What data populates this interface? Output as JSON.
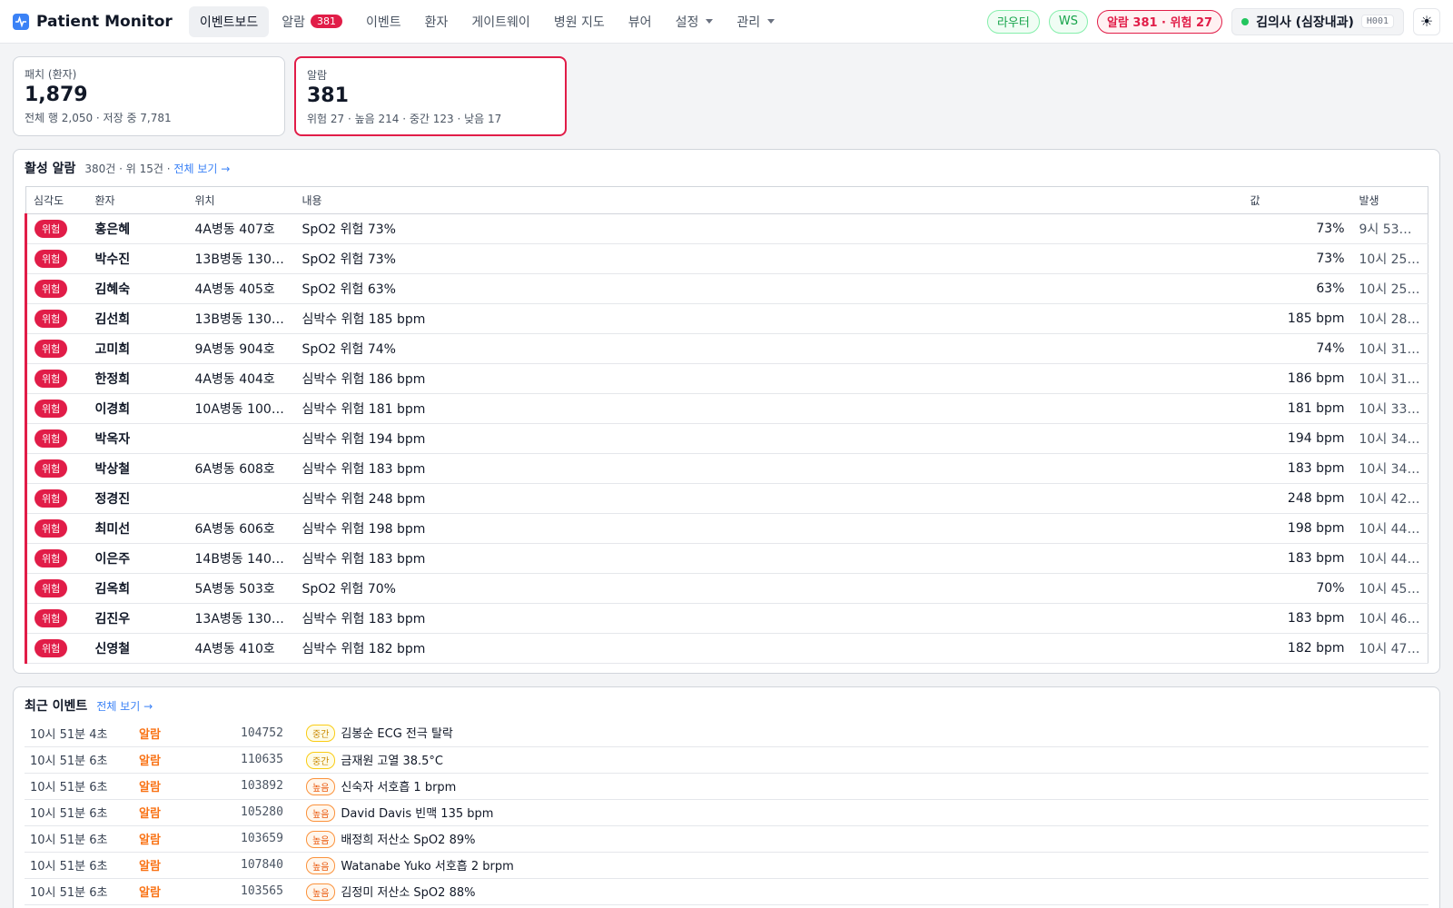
{
  "app": {
    "title": "Patient Monitor"
  },
  "nav": {
    "dashboard": "이벤트보드",
    "alarms": "알람",
    "alarms_count": "381",
    "events": "이벤트",
    "patients": "환자",
    "gateway": "게이트웨이",
    "hospital_map": "병원 지도",
    "viewer": "뷰어",
    "settings": "설정",
    "admin": "관리"
  },
  "status": {
    "router": "라우터",
    "ws": "WS",
    "alarm_summary": "알람 381 · 위험 27"
  },
  "user": {
    "name": "김의사 (심장내과)",
    "code": "H001"
  },
  "stats": {
    "patches": {
      "label": "패치 (환자)",
      "value": "1,879",
      "sub": "전체 행 2,050 · 저장 중 7,781"
    },
    "alarms": {
      "label": "알람",
      "value": "381",
      "sub": "위험 27 · 높음 214 · 중간 123 · 낮음 17"
    }
  },
  "active_alarms": {
    "title": "활성 알람",
    "meta": "380건 · 위 15건 ·",
    "view_all": "전체 보기 →",
    "columns": {
      "severity": "심각도",
      "patient": "환자",
      "location": "위치",
      "content": "내용",
      "value": "값",
      "time": "발생"
    },
    "rows": [
      {
        "severity": "위험",
        "patient": "홍은혜",
        "location": "4A병동 407호",
        "content": "SpO2 위험 73%",
        "value": "73%",
        "time": "9시 53…"
      },
      {
        "severity": "위험",
        "patient": "박수진",
        "location": "13B병동 130…",
        "content": "SpO2 위험 73%",
        "value": "73%",
        "time": "10시 25…"
      },
      {
        "severity": "위험",
        "patient": "김혜숙",
        "location": "4A병동 405호",
        "content": "SpO2 위험 63%",
        "value": "63%",
        "time": "10시 25…"
      },
      {
        "severity": "위험",
        "patient": "김선희",
        "location": "13B병동 130…",
        "content": "심박수 위험 185 bpm",
        "value": "185 bpm",
        "time": "10시 28…"
      },
      {
        "severity": "위험",
        "patient": "고미희",
        "location": "9A병동 904호",
        "content": "SpO2 위험 74%",
        "value": "74%",
        "time": "10시 31…"
      },
      {
        "severity": "위험",
        "patient": "한정희",
        "location": "4A병동 404호",
        "content": "심박수 위험 186 bpm",
        "value": "186 bpm",
        "time": "10시 31…"
      },
      {
        "severity": "위험",
        "patient": "이경희",
        "location": "10A병동 100…",
        "content": "심박수 위험 181 bpm",
        "value": "181 bpm",
        "time": "10시 33…"
      },
      {
        "severity": "위험",
        "patient": "박옥자",
        "location": "",
        "content": "심박수 위험 194 bpm",
        "value": "194 bpm",
        "time": "10시 34…"
      },
      {
        "severity": "위험",
        "patient": "박상철",
        "location": "6A병동 608호",
        "content": "심박수 위험 183 bpm",
        "value": "183 bpm",
        "time": "10시 34…"
      },
      {
        "severity": "위험",
        "patient": "정경진",
        "location": "",
        "content": "심박수 위험 248 bpm",
        "value": "248 bpm",
        "time": "10시 42…"
      },
      {
        "severity": "위험",
        "patient": "최미선",
        "location": "6A병동 606호",
        "content": "심박수 위험 198 bpm",
        "value": "198 bpm",
        "time": "10시 44…"
      },
      {
        "severity": "위험",
        "patient": "이은주",
        "location": "14B병동 140…",
        "content": "심박수 위험 183 bpm",
        "value": "183 bpm",
        "time": "10시 44…"
      },
      {
        "severity": "위험",
        "patient": "김옥희",
        "location": "5A병동 503호",
        "content": "SpO2 위험 70%",
        "value": "70%",
        "time": "10시 45…"
      },
      {
        "severity": "위험",
        "patient": "김진우",
        "location": "13A병동 130…",
        "content": "심박수 위험 183 bpm",
        "value": "183 bpm",
        "time": "10시 46…"
      },
      {
        "severity": "위험",
        "patient": "신영철",
        "location": "4A병동 410호",
        "content": "심박수 위험 182 bpm",
        "value": "182 bpm",
        "time": "10시 47…"
      }
    ]
  },
  "recent_events": {
    "title": "최근 이벤트",
    "view_all": "전체 보기 →",
    "rows": [
      {
        "time": "10시 51분 4초",
        "type": "알람",
        "id": "104752",
        "level": "중간",
        "level_kind": "mid",
        "text": "김봉순 ECG 전극 탈락"
      },
      {
        "time": "10시 51분 6초",
        "type": "알람",
        "id": "110635",
        "level": "중간",
        "level_kind": "mid",
        "text": "금재원 고열 38.5°C"
      },
      {
        "time": "10시 51분 6초",
        "type": "알람",
        "id": "103892",
        "level": "높음",
        "level_kind": "high",
        "text": "신숙자 서호흡 1 brpm"
      },
      {
        "time": "10시 51분 6초",
        "type": "알람",
        "id": "105280",
        "level": "높음",
        "level_kind": "high",
        "text": "David Davis 빈맥 135 bpm"
      },
      {
        "time": "10시 51분 6초",
        "type": "알람",
        "id": "103659",
        "level": "높음",
        "level_kind": "high",
        "text": "배정희 저산소 SpO2 89%"
      },
      {
        "time": "10시 51분 6초",
        "type": "알람",
        "id": "107840",
        "level": "높음",
        "level_kind": "high",
        "text": "Watanabe Yuko 서호흡 2 brpm"
      },
      {
        "time": "10시 51분 6초",
        "type": "알람",
        "id": "103565",
        "level": "높음",
        "level_kind": "high",
        "text": "김정미 저산소 SpO2 88%"
      }
    ]
  }
}
